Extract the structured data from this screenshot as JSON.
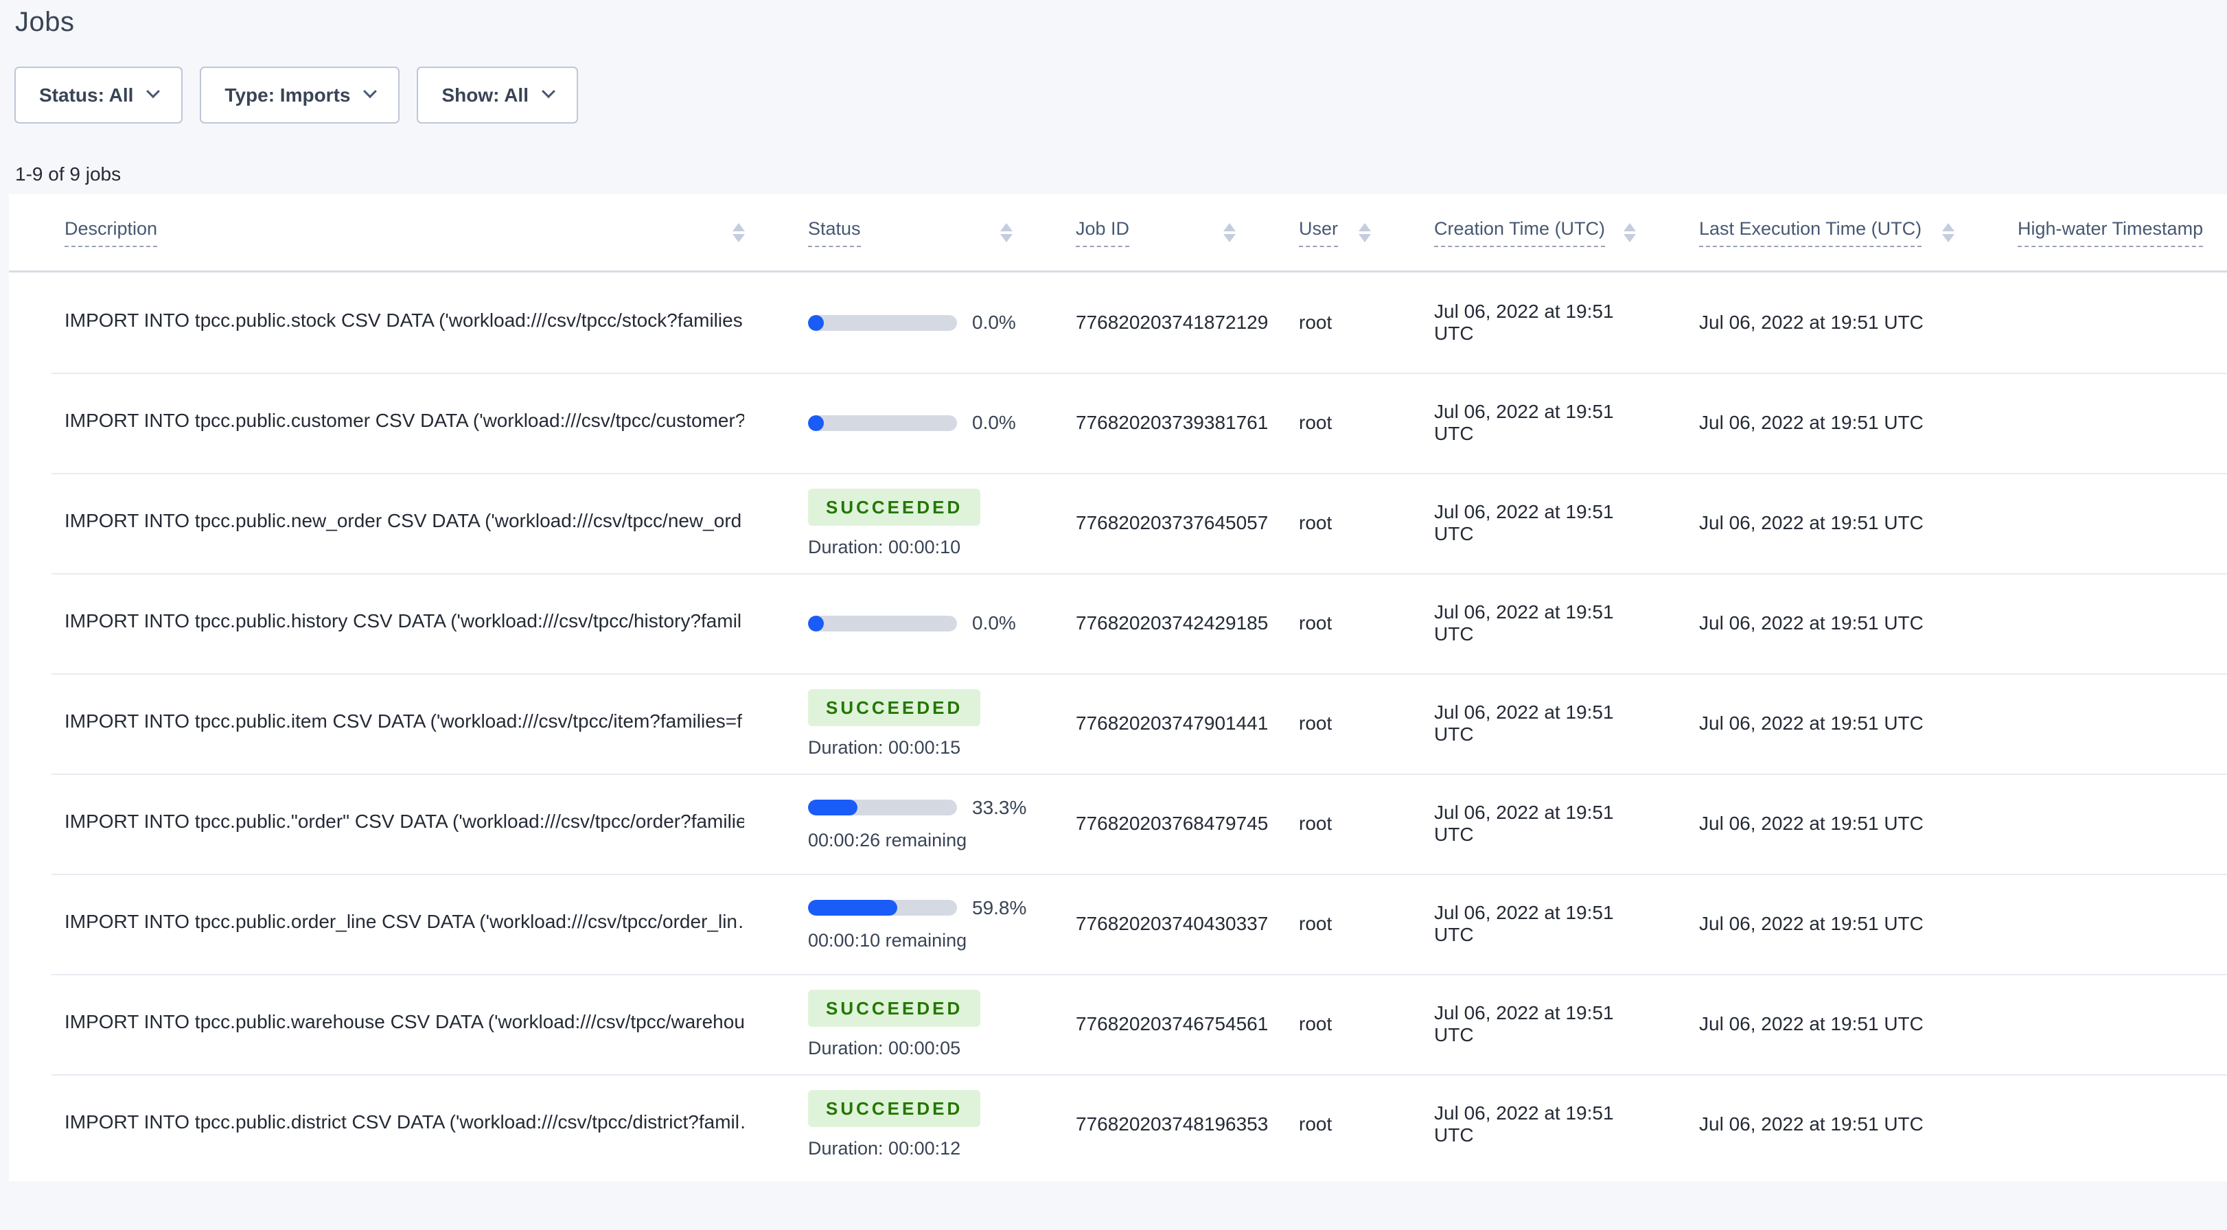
{
  "page": {
    "title": "Jobs",
    "count_label": "1-9 of 9 jobs"
  },
  "filters": [
    {
      "label": "Status: All"
    },
    {
      "label": "Type: Imports"
    },
    {
      "label": "Show: All"
    }
  ],
  "table": {
    "columns": [
      "Description",
      "Status",
      "Job ID",
      "User",
      "Creation Time (UTC)",
      "Last Execution Time (UTC)",
      "High-water Timestamp"
    ],
    "sorted_column": "High-water Timestamp",
    "jobs": [
      {
        "description": "IMPORT INTO tpcc.public.stock CSV DATA ('workload:///csv/tpcc/stock?families…",
        "status": {
          "kind": "progress",
          "percent": "0.0%",
          "fraction": 0.0,
          "remaining": ""
        },
        "job_id": "776820203741872129",
        "user": "root",
        "creation_time": "Jul 06, 2022 at 19:51 UTC",
        "last_execution_time": "Jul 06, 2022 at 19:51 UTC",
        "high_water_timestamp": ""
      },
      {
        "description": "IMPORT INTO tpcc.public.customer CSV DATA ('workload:///csv/tpcc/customer?f…",
        "status": {
          "kind": "progress",
          "percent": "0.0%",
          "fraction": 0.0,
          "remaining": ""
        },
        "job_id": "776820203739381761",
        "user": "root",
        "creation_time": "Jul 06, 2022 at 19:51 UTC",
        "last_execution_time": "Jul 06, 2022 at 19:51 UTC",
        "high_water_timestamp": ""
      },
      {
        "description": "IMPORT INTO tpcc.public.new_order CSV DATA ('workload:///csv/tpcc/new_ord…",
        "status": {
          "kind": "succeeded",
          "label": "SUCCEEDED",
          "duration": "Duration: 00:00:10"
        },
        "job_id": "776820203737645057",
        "user": "root",
        "creation_time": "Jul 06, 2022 at 19:51 UTC",
        "last_execution_time": "Jul 06, 2022 at 19:51 UTC",
        "high_water_timestamp": ""
      },
      {
        "description": "IMPORT INTO tpcc.public.history CSV DATA ('workload:///csv/tpcc/history?famil…",
        "status": {
          "kind": "progress",
          "percent": "0.0%",
          "fraction": 0.0,
          "remaining": ""
        },
        "job_id": "776820203742429185",
        "user": "root",
        "creation_time": "Jul 06, 2022 at 19:51 UTC",
        "last_execution_time": "Jul 06, 2022 at 19:51 UTC",
        "high_water_timestamp": ""
      },
      {
        "description": "IMPORT INTO tpcc.public.item CSV DATA ('workload:///csv/tpcc/item?families=f…",
        "status": {
          "kind": "succeeded",
          "label": "SUCCEEDED",
          "duration": "Duration: 00:00:15"
        },
        "job_id": "776820203747901441",
        "user": "root",
        "creation_time": "Jul 06, 2022 at 19:51 UTC",
        "last_execution_time": "Jul 06, 2022 at 19:51 UTC",
        "high_water_timestamp": ""
      },
      {
        "description": "IMPORT INTO tpcc.public.\"order\" CSV DATA ('workload:///csv/tpcc/order?familie…",
        "status": {
          "kind": "progress",
          "percent": "33.3%",
          "fraction": 0.333,
          "remaining": "00:00:26 remaining"
        },
        "job_id": "776820203768479745",
        "user": "root",
        "creation_time": "Jul 06, 2022 at 19:51 UTC",
        "last_execution_time": "Jul 06, 2022 at 19:51 UTC",
        "high_water_timestamp": ""
      },
      {
        "description": "IMPORT INTO tpcc.public.order_line CSV DATA ('workload:///csv/tpcc/order_lin…",
        "status": {
          "kind": "progress",
          "percent": "59.8%",
          "fraction": 0.598,
          "remaining": "00:00:10 remaining"
        },
        "job_id": "776820203740430337",
        "user": "root",
        "creation_time": "Jul 06, 2022 at 19:51 UTC",
        "last_execution_time": "Jul 06, 2022 at 19:51 UTC",
        "high_water_timestamp": ""
      },
      {
        "description": "IMPORT INTO tpcc.public.warehouse CSV DATA ('workload:///csv/tpcc/warehou…",
        "status": {
          "kind": "succeeded",
          "label": "SUCCEEDED",
          "duration": "Duration: 00:00:05"
        },
        "job_id": "776820203746754561",
        "user": "root",
        "creation_time": "Jul 06, 2022 at 19:51 UTC",
        "last_execution_time": "Jul 06, 2022 at 19:51 UTC",
        "high_water_timestamp": ""
      },
      {
        "description": "IMPORT INTO tpcc.public.district CSV DATA ('workload:///csv/tpcc/district?famil…",
        "status": {
          "kind": "succeeded",
          "label": "SUCCEEDED",
          "duration": "Duration: 00:00:12"
        },
        "job_id": "776820203748196353",
        "user": "root",
        "creation_time": "Jul 06, 2022 at 19:51 UTC",
        "last_execution_time": "Jul 06, 2022 at 19:51 UTC",
        "high_water_timestamp": ""
      }
    ]
  },
  "colors": {
    "accent_blue": "#1A5CF7",
    "progress_track": "#D5D9E2",
    "success_bg": "#DFF3DA",
    "success_text": "#237700",
    "page_bg": "#F5F7FA",
    "header_text": "#475872",
    "body_text": "#242A35"
  }
}
